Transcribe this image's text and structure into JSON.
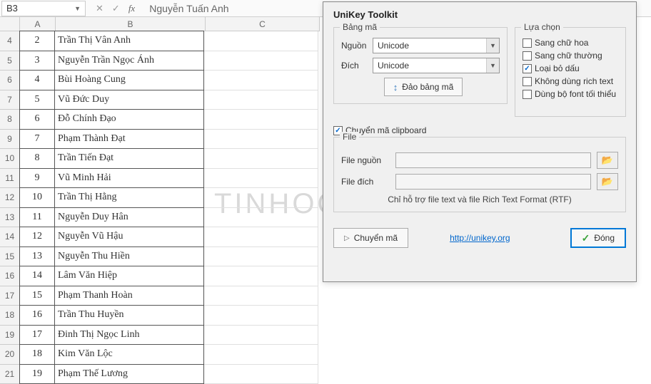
{
  "formula_bar": {
    "cell_ref": "B3",
    "formula": "Nguyễn Tuấn Anh"
  },
  "columns": [
    "A",
    "B",
    "C"
  ],
  "row_numbers": [
    4,
    5,
    6,
    7,
    8,
    9,
    10,
    11,
    12,
    13,
    14,
    15,
    16,
    17,
    18,
    19,
    20,
    21
  ],
  "rows": [
    {
      "a": "2",
      "b": "Trần Thị Vân Anh"
    },
    {
      "a": "3",
      "b": "Nguyễn Trần Ngọc Ánh"
    },
    {
      "a": "4",
      "b": "Bùi Hoàng Cung"
    },
    {
      "a": "5",
      "b": "Vũ Đức Duy"
    },
    {
      "a": "6",
      "b": "Đỗ Chính Đạo"
    },
    {
      "a": "7",
      "b": "Phạm Thành Đạt"
    },
    {
      "a": "8",
      "b": "Trần Tiến Đạt"
    },
    {
      "a": "9",
      "b": "Vũ Minh Hải"
    },
    {
      "a": "10",
      "b": "Trần Thị Hằng"
    },
    {
      "a": "11",
      "b": "Nguyễn Duy Hân"
    },
    {
      "a": "12",
      "b": "Nguyễn Vũ Hậu"
    },
    {
      "a": "13",
      "b": "Nguyễn Thu Hiền"
    },
    {
      "a": "14",
      "b": "Lâm Văn Hiệp"
    },
    {
      "a": "15",
      "b": "Phạm Thanh Hoàn"
    },
    {
      "a": "16",
      "b": "Trần Thu Huyền"
    },
    {
      "a": "17",
      "b": "Đinh Thị Ngọc Linh"
    },
    {
      "a": "18",
      "b": "Kim Văn Lộc"
    },
    {
      "a": "19",
      "b": "Phạm Thế Lương"
    }
  ],
  "watermark": "TINHOCMOS",
  "dialog": {
    "title": "UniKey Toolkit",
    "encoding": {
      "legend": "Bảng mã",
      "source_label": "Nguồn",
      "dest_label": "Đích",
      "source_value": "Unicode",
      "dest_value": "Unicode",
      "swap_label": "Đảo bảng mã"
    },
    "options": {
      "legend": "Lựa chọn",
      "uppercase": "Sang chữ hoa",
      "lowercase": "Sang chữ thường",
      "remove_marks": "Loại bỏ dấu",
      "no_richtext": "Không dùng rich text",
      "min_font": "Dùng bộ font tối thiểu"
    },
    "clipboard_label": "Chuyển mã clipboard",
    "file": {
      "legend": "File",
      "source_label": "File nguồn",
      "dest_label": "File đích",
      "hint": "Chỉ hỗ trợ file text và file Rich Text Format (RTF)"
    },
    "convert_btn": "Chuyển mã",
    "link_text": "http://unikey.org",
    "close_btn": "Đóng"
  }
}
